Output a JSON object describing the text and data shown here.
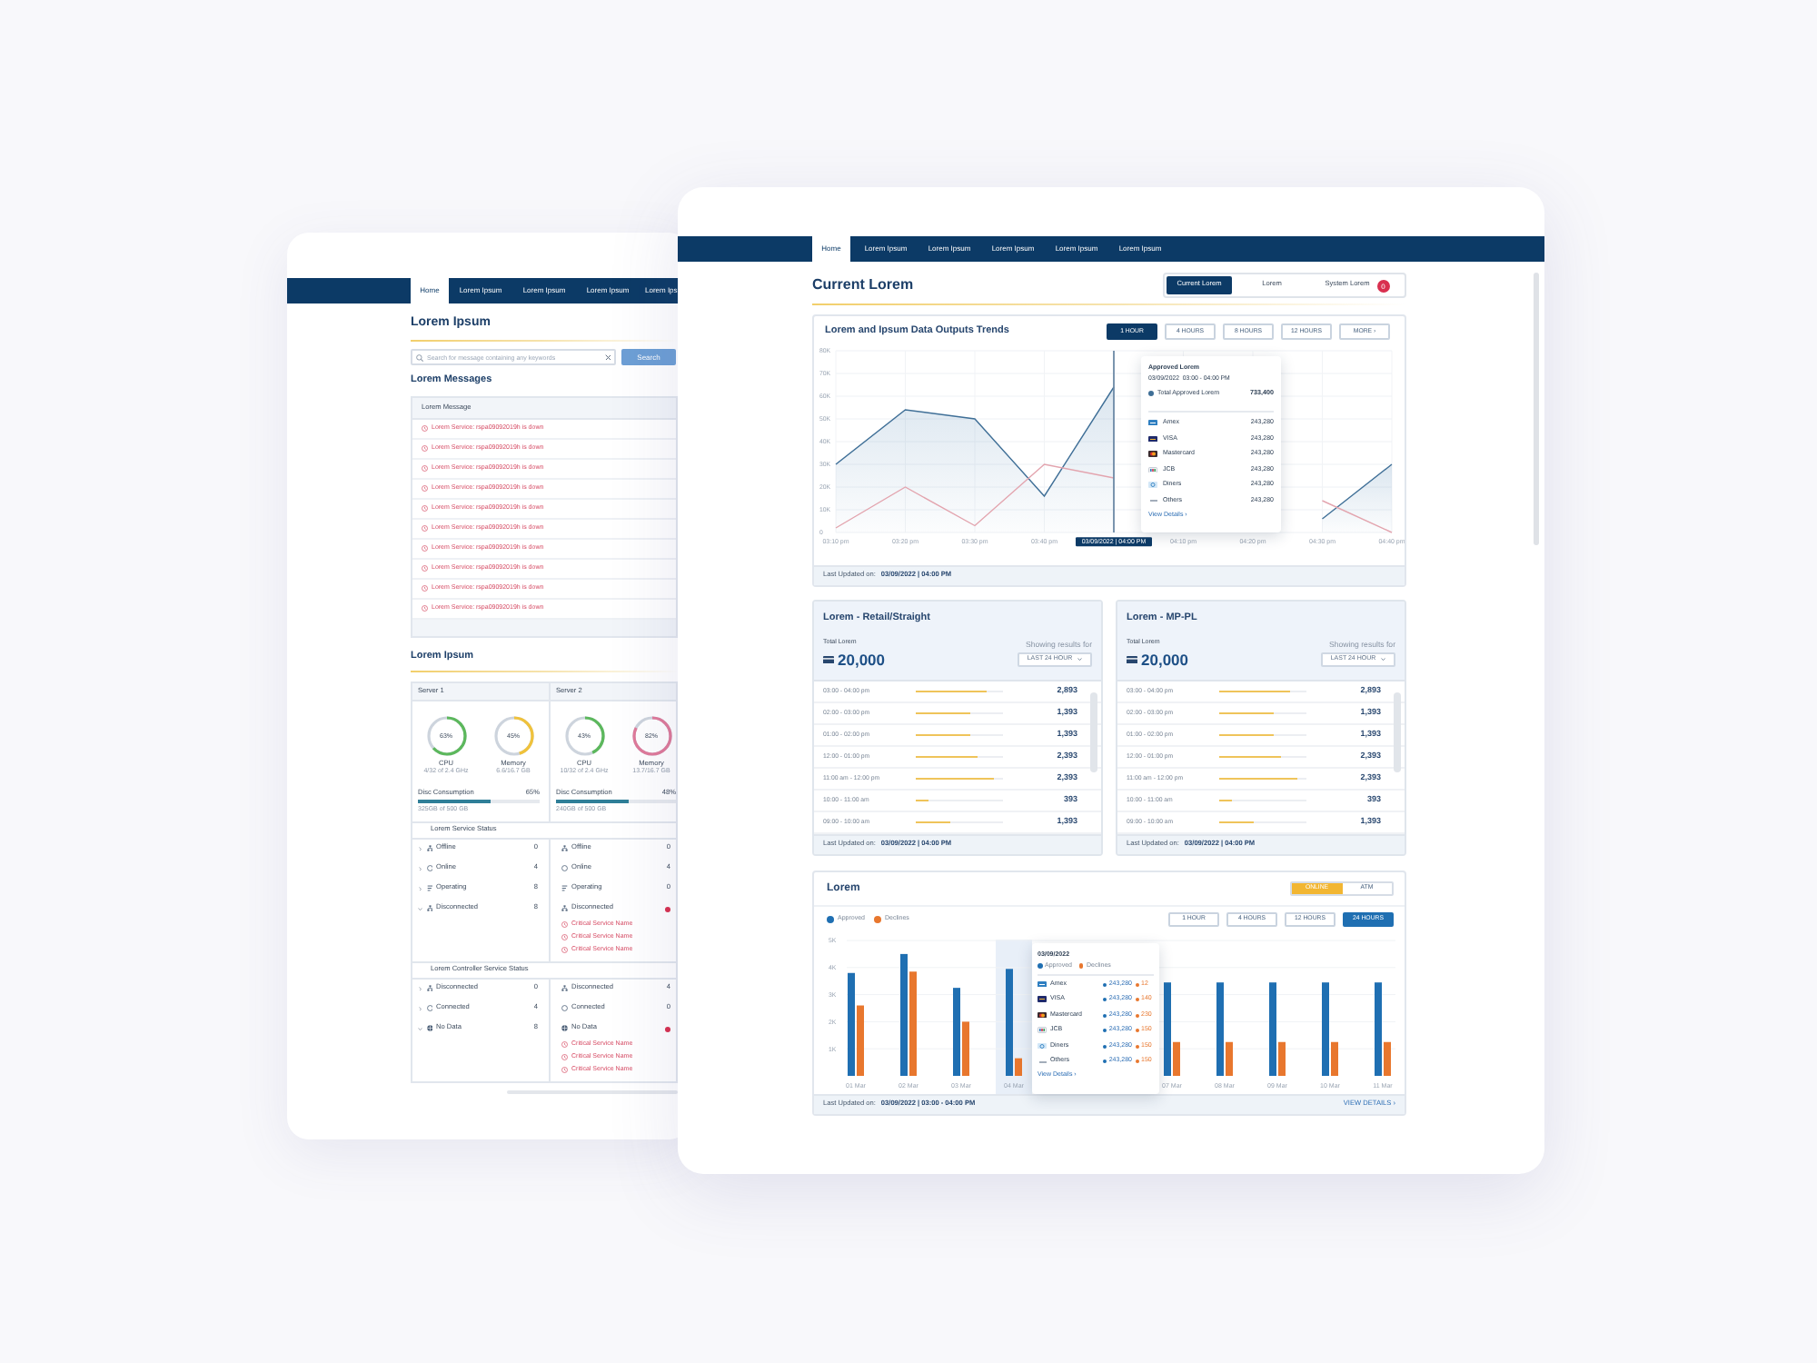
{
  "back_page": {
    "nav_tabs": [
      {
        "label": "Home",
        "selected": true
      },
      {
        "label": "Lorem Ipsum",
        "selected": false
      },
      {
        "label": "Lorem Ipsum",
        "selected": false
      },
      {
        "label": "Lorem Ipsum",
        "selected": false
      },
      {
        "label": "Lorem Ips",
        "selected": false
      }
    ],
    "title": "Lorem Ipsum",
    "search": {
      "placeholder": "Search for message containing any keywords",
      "button": "Search"
    },
    "messages": {
      "heading": "Lorem Messages",
      "column": "Lorem Message",
      "rows": [
        "Lorem Service: rspa09092019h is down",
        "Lorem Service: rspa09092019h is down",
        "Lorem Service: rspa09092019h is down",
        "Lorem Service: rspa09092019h is down",
        "Lorem Service: rspa09092019h is down",
        "Lorem Service: rspa09092019h is down",
        "Lorem Service: rspa09092019h is down",
        "Lorem Service: rspa09092019h is down",
        "Lorem Service: rspa09092019h is down",
        "Lorem Service: rspa09092019h is down"
      ]
    },
    "servers_heading": "Lorem Ipsum",
    "servers": [
      {
        "name": "Server 1",
        "gauges": [
          {
            "label": "CPU",
            "value": "63%",
            "detail": "4/32 of 2.4 GHz",
            "level": 0.63,
            "color": "#5cb85c"
          },
          {
            "label": "Memory",
            "value": "45%",
            "detail": "6.6/16.7 GB",
            "level": 0.45,
            "color": "#f0c23b"
          }
        ],
        "disc": {
          "label": "Disc Consumption",
          "value": "65%",
          "level": 0.6,
          "detail": "325GB of 500 GB"
        }
      },
      {
        "name": "Server 2",
        "gauges": [
          {
            "label": "CPU",
            "value": "43%",
            "detail": "10/32 of 2.4 GHz",
            "level": 0.43,
            "color": "#5cb85c"
          },
          {
            "label": "Memory",
            "value": "82%",
            "detail": "13.7/16.7 GB",
            "level": 0.82,
            "color": "#e07a9a"
          }
        ],
        "disc": {
          "label": "Disc Consumption",
          "value": "48%",
          "level": 0.6,
          "detail": "240GB of 500 GB"
        }
      }
    ],
    "status_sections": [
      {
        "title": "Lorem Service Status",
        "rows": [
          {
            "kind": "offline",
            "expanded": false,
            "cells": [
              {
                "label": "Offline",
                "count": "0",
                "alert": false
              },
              {
                "label": "Offline",
                "count": "0",
                "alert": false
              }
            ]
          },
          {
            "kind": "online",
            "expanded": false,
            "cells": [
              {
                "label": "Online",
                "count": "4",
                "alert": false
              },
              {
                "label": "Online",
                "count": "4",
                "alert": false
              }
            ]
          },
          {
            "kind": "operating",
            "expanded": false,
            "cells": [
              {
                "label": "Operating",
                "count": "8",
                "alert": false
              },
              {
                "label": "Operating",
                "count": "0",
                "alert": false
              }
            ]
          },
          {
            "kind": "disconnected",
            "expanded": true,
            "cells": [
              {
                "label": "Disconnected",
                "count": "8",
                "alert": false
              },
              {
                "label": "Disconnected",
                "alert": true,
                "issues": [
                  "Critical Service Name",
                  "Critical Service Name",
                  "Critical Service Name"
                ]
              }
            ]
          }
        ]
      },
      {
        "title": "Lorem Controller Service Status",
        "rows": [
          {
            "kind": "disconnected",
            "expanded": false,
            "cells": [
              {
                "label": "Disconnected",
                "count": "0",
                "alert": false
              },
              {
                "label": "Disconnected",
                "count": "4",
                "alert": false
              }
            ]
          },
          {
            "kind": "connected",
            "expanded": false,
            "cells": [
              {
                "label": "Connected",
                "count": "4",
                "alert": false
              },
              {
                "label": "Connected",
                "count": "0",
                "alert": false
              }
            ]
          },
          {
            "kind": "nodata",
            "expanded": true,
            "cells": [
              {
                "label": "No Data",
                "count": "8",
                "alert": false
              },
              {
                "label": "No Data",
                "alert": true,
                "issues": [
                  "Critical Service Name",
                  "Critical Service Name",
                  "Critical Service Name"
                ]
              }
            ]
          }
        ]
      }
    ]
  },
  "front_page": {
    "nav_tabs": [
      {
        "label": "Home",
        "selected": true
      },
      {
        "label": "Lorem Ipsum",
        "selected": false
      },
      {
        "label": "Lorem Ipsum",
        "selected": false
      },
      {
        "label": "Lorem Ipsum",
        "selected": false
      },
      {
        "label": "Lorem Ipsum",
        "selected": false
      },
      {
        "label": "Lorem Ipsum",
        "selected": false
      }
    ],
    "title": "Current Lorem",
    "views": [
      {
        "label": "Current Lorem",
        "selected": true
      },
      {
        "label": "Lorem",
        "selected": false
      },
      {
        "label": "System Lorem",
        "selected": false,
        "badge": "0"
      }
    ],
    "trends": {
      "title": "Lorem and Ipsum Data Outputs Trends",
      "ranges": [
        {
          "label": "1 HOUR",
          "selected": true
        },
        {
          "label": "4 HOURS",
          "selected": false
        },
        {
          "label": "8 HOURS",
          "selected": false
        },
        {
          "label": "12 HOURS",
          "selected": false
        },
        {
          "label": "MORE ›",
          "selected": false
        }
      ],
      "chart_data": {
        "type": "line",
        "categories": [
          "03:10 pm",
          "03:20 pm",
          "03:30 pm",
          "03:40 pm",
          "03/09/2022 | 04:00 PM",
          "04:10 pm",
          "04:20 pm",
          "04:30 pm",
          "04:40 pm"
        ],
        "ylim": [
          0,
          80000
        ],
        "yticks": [
          {
            "value": 0,
            "label": "0"
          },
          {
            "value": 10000,
            "label": "10K"
          },
          {
            "value": 20000,
            "label": "20K"
          },
          {
            "value": 30000,
            "label": "30K"
          },
          {
            "value": 40000,
            "label": "40K"
          },
          {
            "value": 50000,
            "label": "50K"
          },
          {
            "value": 60000,
            "label": "60K"
          },
          {
            "value": 70000,
            "label": "70K"
          },
          {
            "value": 80000,
            "label": "80K"
          }
        ],
        "grid": true,
        "ref_lines": [
          {
            "axis": "x",
            "value": "03/09/2022 | 04:00 PM",
            "color": "#6d8aa6"
          }
        ],
        "series": [
          {
            "type": "area",
            "color": "#3f6f97",
            "values": [
              30000,
              54000,
              50000,
              16000,
              64000,
              null,
              null,
              6000,
              30000
            ]
          },
          {
            "type": "line",
            "color": "#e3a4ae",
            "values": [
              2000,
              20000,
              3000,
              30000,
              24000,
              null,
              null,
              14000,
              0
            ]
          }
        ]
      },
      "tooltip": {
        "title": "Approved Lorem",
        "time": "03/09/2022  03:00 - 04:00 PM",
        "total_label": "Total Approved Lorem",
        "total": "733,400",
        "rows": [
          {
            "kind": "amex",
            "name": "Amex",
            "value": "243,280"
          },
          {
            "kind": "visa",
            "name": "VISA",
            "value": "243,280"
          },
          {
            "kind": "mastercard",
            "name": "Mastercard",
            "value": "243,280"
          },
          {
            "kind": "jcb",
            "name": "JCB",
            "value": "243,280"
          },
          {
            "kind": "diners",
            "name": "Diners",
            "value": "243,280"
          },
          {
            "kind": "others",
            "name": "Others",
            "value": "243,280"
          }
        ],
        "link": "View Details ›"
      },
      "updated_label": "Last Updated on:",
      "updated_value": "03/09/2022 | 04:00 PM"
    },
    "panels": [
      {
        "title": "Lorem - Retail/Straight",
        "total_label": "Total Lorem",
        "total": "20,000",
        "filter_label": "Showing results for",
        "filter": "LAST 24 HOUR",
        "rows": [
          {
            "time": "03:00 - 04:00 pm",
            "level": 0.81,
            "value": "2,893"
          },
          {
            "time": "02:00 - 03:00 pm",
            "level": 0.63,
            "value": "1,393"
          },
          {
            "time": "01:00 - 02:00 pm",
            "level": 0.63,
            "value": "1,393"
          },
          {
            "time": "12:00 - 01:00 pm",
            "level": 0.7,
            "value": "2,393"
          },
          {
            "time": "11:00 am - 12:00 pm",
            "level": 0.9,
            "value": "2,393"
          },
          {
            "time": "10:00 - 11:00 am",
            "level": 0.15,
            "value": "393"
          },
          {
            "time": "09:00 - 10:00 am",
            "level": 0.39,
            "value": "1,393"
          }
        ],
        "updated_label": "Last Updated on:",
        "updated_value": "03/09/2022 | 04:00 PM"
      },
      {
        "title": "Lorem - MP-PL",
        "total_label": "Total Lorem",
        "total": "20,000",
        "filter_label": "Showing results for",
        "filter": "LAST 24 HOUR",
        "rows": [
          {
            "time": "03:00 - 04:00 pm",
            "level": 0.81,
            "value": "2,893"
          },
          {
            "time": "02:00 - 03:00 pm",
            "level": 0.63,
            "value": "1,393"
          },
          {
            "time": "01:00 - 02:00 pm",
            "level": 0.63,
            "value": "1,393"
          },
          {
            "time": "12:00 - 01:00 pm",
            "level": 0.7,
            "value": "2,393"
          },
          {
            "time": "11:00 am - 12:00 pm",
            "level": 0.9,
            "value": "2,393"
          },
          {
            "time": "10:00 - 11:00 am",
            "level": 0.15,
            "value": "393"
          },
          {
            "time": "09:00 - 10:00 am",
            "level": 0.39,
            "value": "1,393"
          }
        ],
        "updated_label": "Last Updated on:",
        "updated_value": "03/09/2022 | 04:00 PM"
      }
    ],
    "volume": {
      "title": "Lorem",
      "channels": [
        {
          "label": "ONLINE",
          "selected": true
        },
        {
          "label": "ATM",
          "selected": false
        }
      ],
      "ranges": [
        {
          "label": "1 HOUR",
          "selected": false
        },
        {
          "label": "4 HOURS",
          "selected": false
        },
        {
          "label": "12 HOURS",
          "selected": false
        },
        {
          "label": "24 HOURS",
          "selected": true
        }
      ],
      "chart_data": {
        "type": "bar",
        "categories": [
          "01 Mar",
          "02 Mar",
          "03 Mar",
          "04 Mar",
          null,
          null,
          "07 Mar",
          "08 Mar",
          "09 Mar",
          "10 Mar",
          "11 Mar"
        ],
        "grid": true,
        "ylim": [
          0,
          5000
        ],
        "yticks": [
          {
            "value": 1000,
            "label": "1K"
          },
          {
            "value": 2000,
            "label": "2K"
          },
          {
            "value": 3000,
            "label": "3K"
          },
          {
            "value": 4000,
            "label": "4K"
          },
          {
            "value": 5000,
            "label": "5K"
          }
        ],
        "bands": [
          {
            "axis": "x",
            "from": "04 Mar",
            "to": "04 Mar",
            "color": "#e8eff8"
          }
        ],
        "series": [
          {
            "name": "Approved",
            "color": "#1f6fb2",
            "values": [
              3800,
              4500,
              3250,
              3950,
              null,
              null,
              3450,
              3450,
              3450,
              3450,
              3450
            ]
          },
          {
            "name": "Declines",
            "color": "#e8772e",
            "values": [
              2600,
              3850,
              2000,
              650,
              null,
              null,
              1250,
              1250,
              1250,
              1250,
              1250
            ]
          }
        ]
      },
      "tooltip": {
        "date": "03/09/2022",
        "legend": [
          "Approved",
          "Declines"
        ],
        "rows": [
          {
            "kind": "amex",
            "name": "Amex",
            "approved": "243,280",
            "declines": "12"
          },
          {
            "kind": "visa",
            "name": "VISA",
            "approved": "243,280",
            "declines": "140"
          },
          {
            "kind": "mastercard",
            "name": "Mastercard",
            "approved": "243,280",
            "declines": "230"
          },
          {
            "kind": "jcb",
            "name": "JCB",
            "approved": "243,280",
            "declines": "150"
          },
          {
            "kind": "diners",
            "name": "Diners",
            "approved": "243,280",
            "declines": "150"
          },
          {
            "kind": "others",
            "name": "Others",
            "approved": "243,280",
            "declines": "150"
          }
        ],
        "link": "View Details ›"
      },
      "updated_label": "Last Updated on:",
      "updated_value": "03/09/2022 | 03:00 - 04:00 PM",
      "details_link": "VIEW DETAILS ›"
    }
  }
}
